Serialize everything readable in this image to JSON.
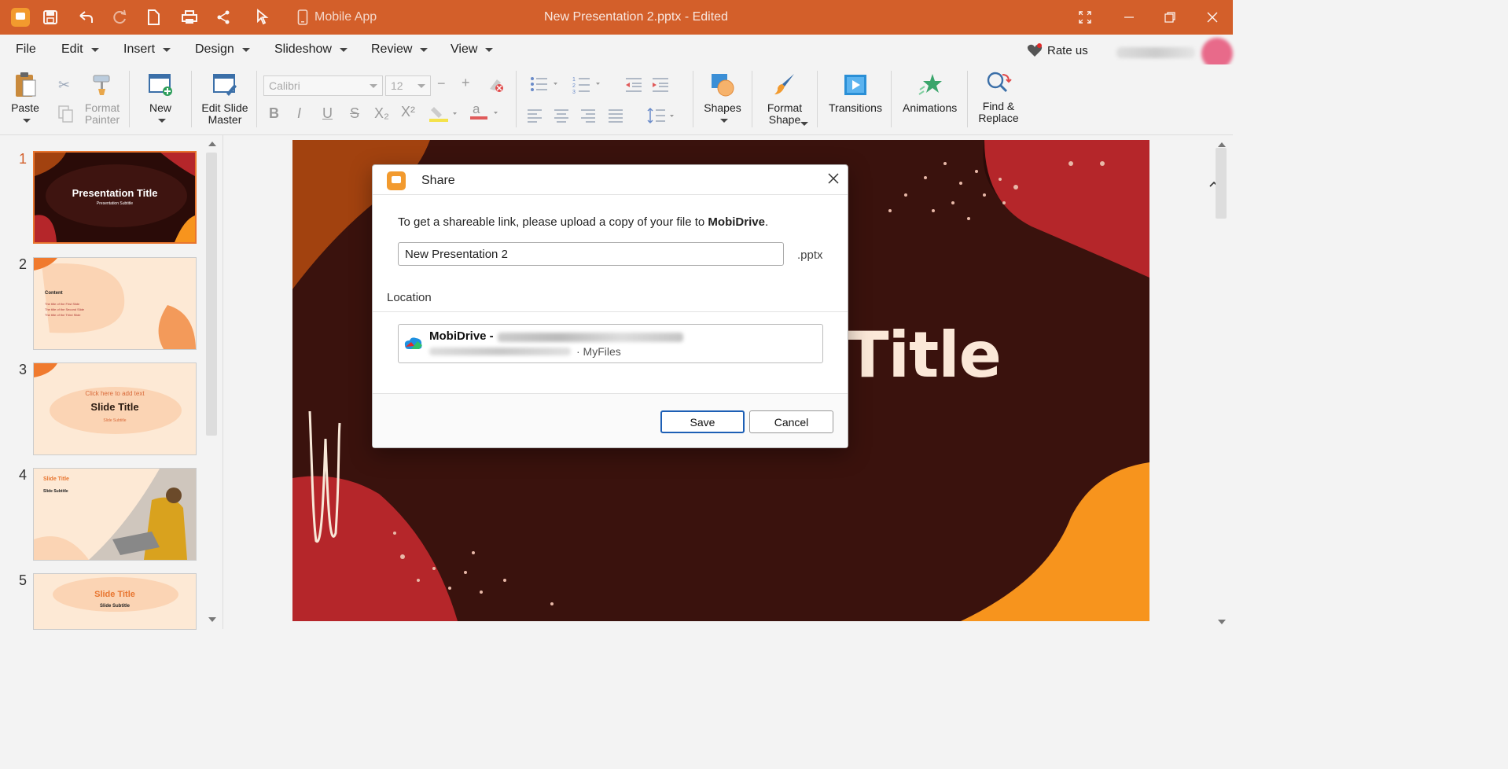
{
  "titlebar": {
    "quick_access": [
      "logo-icon",
      "save-icon",
      "undo-icon",
      "redo-icon",
      "new-doc-icon",
      "print-icon",
      "share-icon",
      "pointer-icon"
    ],
    "mobile_app_label": "Mobile App",
    "document_title": "New Presentation 2.pptx - Edited",
    "window_controls": [
      "fullscreen-icon",
      "minimize-icon",
      "restore-icon",
      "close-icon"
    ]
  },
  "menu": {
    "items": [
      {
        "label": "File",
        "has_caret": false
      },
      {
        "label": "Edit",
        "has_caret": true
      },
      {
        "label": "Insert",
        "has_caret": true
      },
      {
        "label": "Design",
        "has_caret": true
      },
      {
        "label": "Slideshow",
        "has_caret": true
      },
      {
        "label": "Review",
        "has_caret": true
      },
      {
        "label": "View",
        "has_caret": true
      }
    ],
    "rate_us": "Rate us"
  },
  "ribbon": {
    "paste": "Paste",
    "format_painter": "Format Painter",
    "new": "New",
    "edit_slide_master": "Edit Slide Master",
    "font_name": "Calibri",
    "font_size": "12",
    "shapes": "Shapes",
    "format_shape": "Format Shape",
    "transitions": "Transitions",
    "animations": "Animations",
    "find_replace": "Find & Replace",
    "format_buttons": [
      "B",
      "I",
      "U",
      "S",
      "X₂",
      "X²"
    ]
  },
  "slides": [
    {
      "number": "1",
      "title": "Presentation Title",
      "subtitle": "Presentation Subtitle",
      "active": true
    },
    {
      "number": "2",
      "title": "Content",
      "items": [
        "The title of the First Slide",
        "The title of the Second Slide",
        "The title of the Third Slide"
      ]
    },
    {
      "number": "3",
      "title": "Slide Title",
      "top": "Click here to add text",
      "subtitle": "Slide Subtitle"
    },
    {
      "number": "4",
      "title": "Slide Title",
      "subtitle": "Slide Subtitle"
    },
    {
      "number": "5",
      "title": "Slide Title",
      "subtitle": "Slide Subtitle"
    }
  ],
  "main_slide": {
    "visible_title_fragment": "Title"
  },
  "dialog": {
    "title": "Share",
    "message_prefix": "To get a shareable link, please upload a copy of your file to ",
    "message_service": "MobiDrive",
    "message_suffix": ".",
    "file_name": "New Presentation 2",
    "extension": ".pptx",
    "location_label": "Location",
    "location_name": "MobiDrive -",
    "location_path": "· MyFiles",
    "save_label": "Save",
    "cancel_label": "Cancel"
  },
  "colors": {
    "titlebar": "#d35f2a",
    "accent_orange": "#f7941d",
    "slide_background": "#2a0b08",
    "button_focus": "#1d5fb5"
  }
}
